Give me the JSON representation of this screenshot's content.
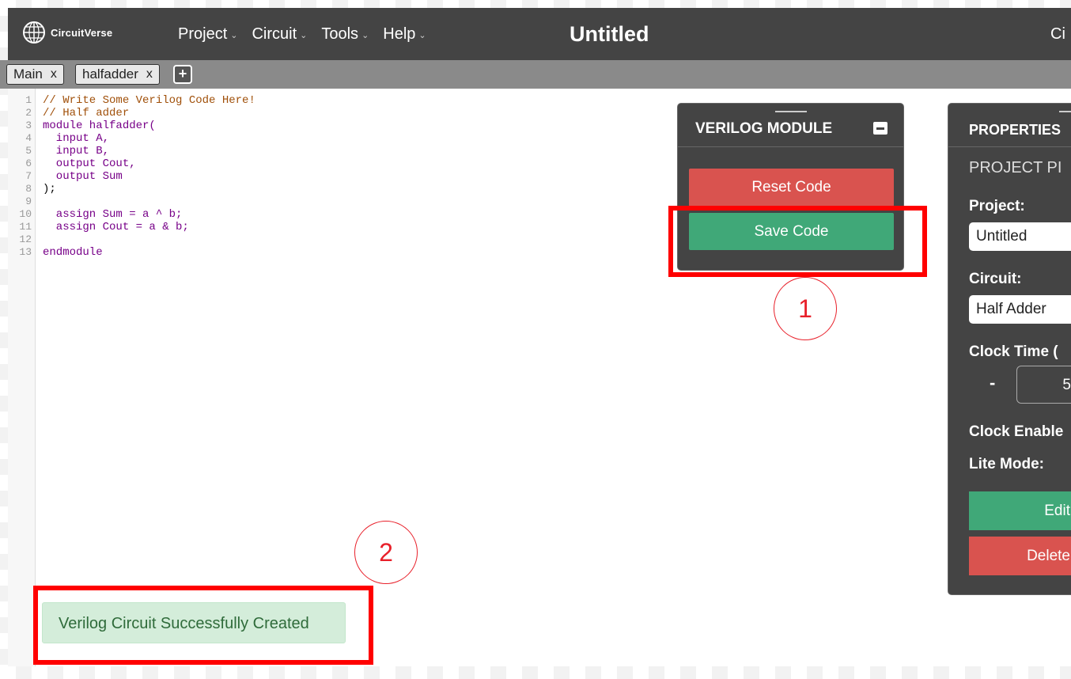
{
  "navbar": {
    "logo_text": "CircuitVerse",
    "menu": [
      {
        "label": "Project"
      },
      {
        "label": "Circuit"
      },
      {
        "label": "Tools"
      },
      {
        "label": "Help"
      }
    ],
    "title": "Untitled",
    "right_truncated": "Ci"
  },
  "tabs": [
    {
      "label": "Main",
      "close": "x"
    },
    {
      "label": "halfadder",
      "close": "x"
    }
  ],
  "tab_add": "+",
  "editor": {
    "line_numbers": [
      "1",
      "2",
      "3",
      "4",
      "5",
      "6",
      "7",
      "8",
      "9",
      "10",
      "11",
      "12",
      "13"
    ],
    "lines": [
      {
        "t": "// Write Some Verilog Code Here!",
        "c": "comment"
      },
      {
        "t": "// Half adder",
        "c": "comment"
      },
      {
        "t": "module halfadder(",
        "c": "kw"
      },
      {
        "t": "  input A,",
        "c": "kw"
      },
      {
        "t": "  input B,",
        "c": "kw"
      },
      {
        "t": "  output Cout,",
        "c": "kw"
      },
      {
        "t": "  output Sum",
        "c": "kw"
      },
      {
        "t": ");",
        "c": "ident"
      },
      {
        "t": "",
        "c": "ident"
      },
      {
        "t": "  assign Sum = a ^ b;",
        "c": "kw"
      },
      {
        "t": "  assign Cout = a & b;",
        "c": "kw"
      },
      {
        "t": "",
        "c": "ident"
      },
      {
        "t": "endmodule",
        "c": "kw"
      }
    ]
  },
  "verilog_panel": {
    "title": "VERILOG MODULE",
    "reset_label": "Reset Code",
    "save_label": "Save Code"
  },
  "properties_panel": {
    "title": "PROPERTIES",
    "subtitle": "PROJECT PI",
    "project_label": "Project:",
    "project_value": "Untitled",
    "circuit_label": "Circuit:",
    "circuit_value": "Half Adder",
    "clock_time_label": "Clock Time (",
    "clock_minus": "-",
    "clock_value": "5",
    "clock_enable_label": "Clock Enable",
    "lite_mode_label": "Lite Mode:",
    "edit_label": "Edit",
    "delete_label": "Delete"
  },
  "toast": {
    "message": "Verilog Circuit Successfully Created"
  },
  "annotations": {
    "callout_1": "1",
    "callout_2": "2",
    "highlight_color": "#ff0000"
  }
}
